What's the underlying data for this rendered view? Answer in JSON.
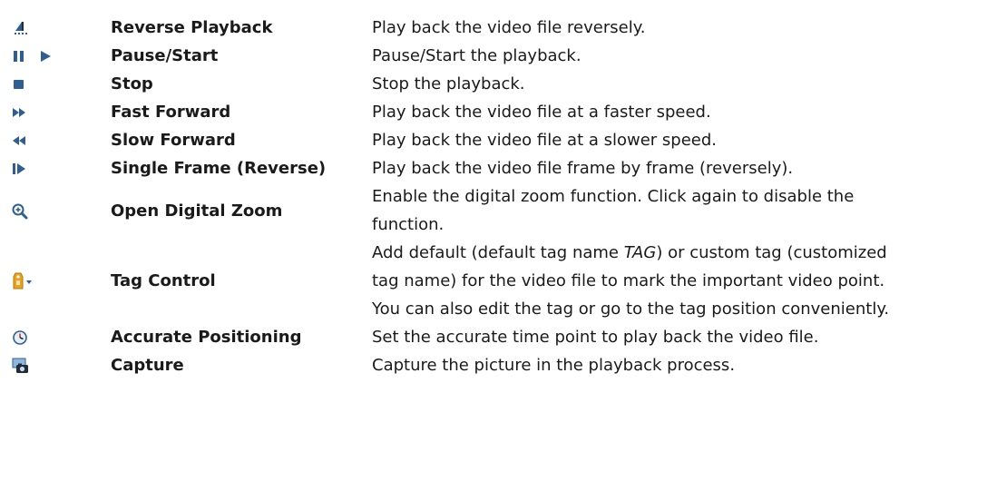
{
  "rows": [
    {
      "name": "Reverse Playback",
      "icons": [
        "reverse-playback-icon"
      ],
      "desc": [
        "Play back the video file reversely."
      ]
    },
    {
      "name": "Pause/Start",
      "icons": [
        "pause-icon",
        "play-icon"
      ],
      "desc": [
        "Pause/Start the playback."
      ]
    },
    {
      "name": "Stop",
      "icons": [
        "stop-icon"
      ],
      "desc": [
        "Stop the playback."
      ]
    },
    {
      "name": "Fast Forward",
      "icons": [
        "fast-forward-icon"
      ],
      "desc": [
        "Play back the video file at a faster speed."
      ]
    },
    {
      "name": "Slow Forward",
      "icons": [
        "slow-forward-icon"
      ],
      "desc": [
        "Play back the video file at a slower speed."
      ]
    },
    {
      "name": "Single Frame (Reverse)",
      "icons": [
        "single-frame-icon"
      ],
      "desc": [
        "Play back the video file frame by frame (reversely)."
      ]
    },
    {
      "name": "Open Digital Zoom",
      "icons": [
        "zoom-in-icon"
      ],
      "desc": [
        "Enable the digital zoom function. Click again to disable the",
        "function."
      ]
    },
    {
      "name": "Tag Control",
      "icons": [
        "tag-dropdown-icon"
      ],
      "desc_tag": {
        "before": "Add default (default tag name ",
        "italic": "TAG",
        "after": ") or custom tag (customized"
      },
      "desc": [
        "tag name) for the video file to mark the important video point.",
        "You can also edit the tag or go to the tag position conveniently."
      ]
    },
    {
      "name": "Accurate Positioning",
      "icons": [
        "clock-position-icon"
      ],
      "desc": [
        "Set the accurate time point to play back the video file."
      ]
    },
    {
      "name": "Capture",
      "icons": [
        "camera-capture-icon"
      ],
      "desc": [
        "Capture the picture in the playback process."
      ]
    }
  ],
  "colors": {
    "icon_blue": "#2f5f92",
    "icon_dark": "#1e2c3c",
    "tag_orange": "#e8a21c",
    "text": "#1a1a1a"
  }
}
